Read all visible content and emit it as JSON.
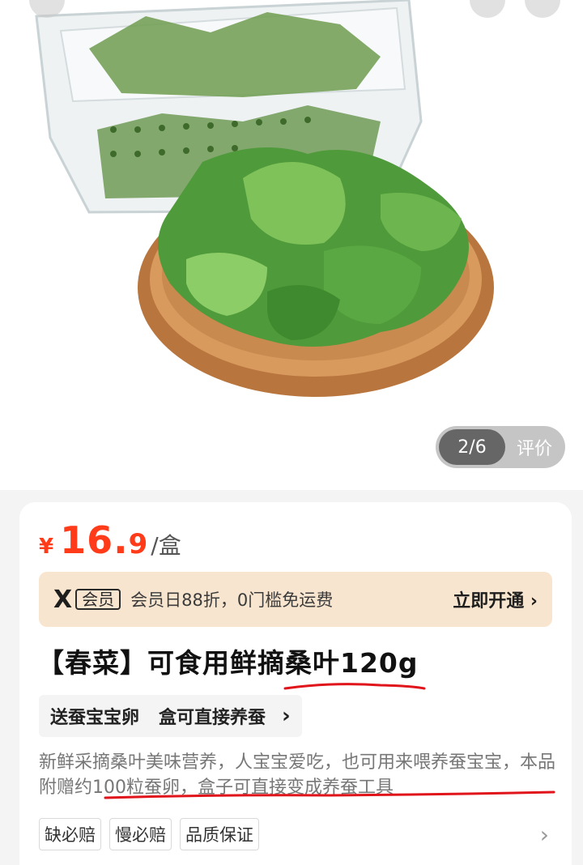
{
  "gallery": {
    "page_indicator": "2/6",
    "review_label": "评价"
  },
  "price": {
    "currency": "¥",
    "integer": "16.",
    "decimal": "9",
    "unit": "/盒"
  },
  "vip_banner": {
    "logo": "X",
    "tag": "会员",
    "text": "会员日88折，0门槛免运费",
    "cta": "立即开通 ›"
  },
  "product": {
    "title": "【春菜】可食用鲜摘桑叶120g",
    "gift_tags": [
      "送蚕宝宝卵",
      "盒可直接养蚕"
    ],
    "description": "新鲜采摘桑叶美味营养，人宝宝爱吃，也可用来喂养蚕宝宝，本品附赠约100粒蚕卵，盒子可直接变成养蚕工具"
  },
  "guarantees": [
    "缺必赔",
    "慢必赔",
    "品质保证"
  ],
  "colors": {
    "price_red": "#ff3b1a",
    "vip_bg": "#f8e5cf",
    "annotation_red": "#e0141a"
  }
}
